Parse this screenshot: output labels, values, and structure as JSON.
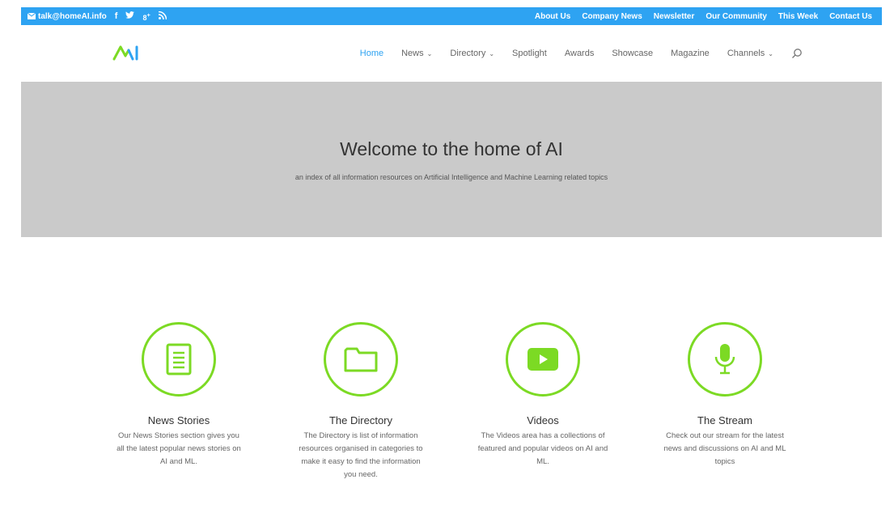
{
  "topbar": {
    "email": "talk@homeAI.info",
    "social_icons": [
      "facebook-icon",
      "twitter-icon",
      "google-plus-icon",
      "rss-icon"
    ],
    "links": [
      "About Us",
      "Company News",
      "Newsletter",
      "Our Community",
      "This Week",
      "Contact Us"
    ]
  },
  "header": {
    "nav": [
      {
        "label": "Home",
        "active": true,
        "dropdown": false
      },
      {
        "label": "News",
        "active": false,
        "dropdown": true
      },
      {
        "label": "Directory",
        "active": false,
        "dropdown": true
      },
      {
        "label": "Spotlight",
        "active": false,
        "dropdown": false
      },
      {
        "label": "Awards",
        "active": false,
        "dropdown": false
      },
      {
        "label": "Showcase",
        "active": false,
        "dropdown": false
      },
      {
        "label": "Magazine",
        "active": false,
        "dropdown": false
      },
      {
        "label": "Channels",
        "active": false,
        "dropdown": true
      }
    ],
    "dropdown_glyph": "⌄"
  },
  "hero": {
    "title": "Welcome to the home of AI",
    "subtitle": "an index of all information resources on Artificial Intelligence and Machine Learning related topics"
  },
  "features": [
    {
      "title": "News Stories",
      "text": "Our News Stories section gives you all the latest popular news stories on AI and ML.",
      "icon": "document-icon"
    },
    {
      "title": "The Directory",
      "text": "The Directory is list of information resources organised in categories to make it easy to find the information you need.",
      "icon": "folder-icon"
    },
    {
      "title": "Videos",
      "text": "The Videos area has a collections of featured and popular videos on AI and ML.",
      "icon": "video-play-icon"
    },
    {
      "title": "The Stream",
      "text": "Check out our stream for the latest news and discussions on AI and ML topics",
      "icon": "microphone-icon"
    }
  ],
  "colors": {
    "topbar": "#2ea3f2",
    "accent": "#7cda24",
    "hero_bg": "#cacaca",
    "nav_active": "#2ea3f2"
  }
}
